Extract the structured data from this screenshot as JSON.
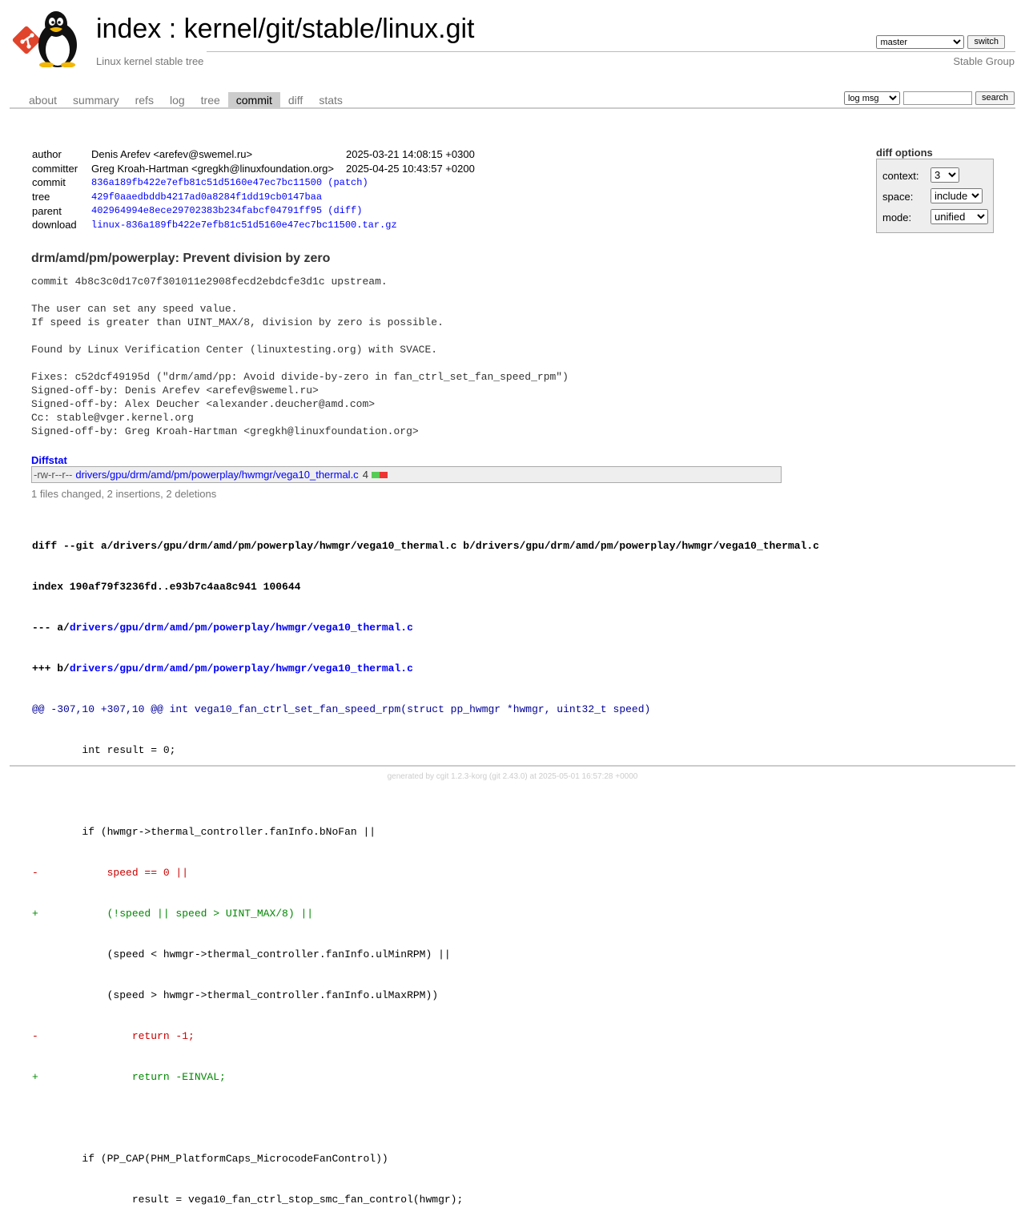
{
  "header": {
    "title_index": "index",
    "title_sep": " : ",
    "title_repo": "kernel/git/stable/linux.git",
    "subtitle": "Linux kernel stable tree",
    "owner": "Stable Group",
    "branch_selected": "master",
    "switch_label": "switch"
  },
  "tabs": [
    {
      "label": "about"
    },
    {
      "label": "summary"
    },
    {
      "label": "refs"
    },
    {
      "label": "log"
    },
    {
      "label": "tree"
    },
    {
      "label": "commit",
      "active": true
    },
    {
      "label": "diff"
    },
    {
      "label": "stats"
    }
  ],
  "search": {
    "mode_selected": "log msg",
    "query": "",
    "button_label": "search"
  },
  "commit_info": {
    "author_label": "author",
    "author": "Denis Arefev <arefev@swemel.ru>",
    "author_date": "2025-03-21 14:08:15 +0300",
    "committer_label": "committer",
    "committer": "Greg Kroah-Hartman <gregkh@linuxfoundation.org>",
    "committer_date": "2025-04-25 10:43:57 +0200",
    "commit_label": "commit",
    "commit_sha": "836a189fb422e7efb81c51d5160e47ec7bc11500",
    "patch_link": "patch",
    "tree_label": "tree",
    "tree_sha": "429f0aaedbddb4217ad0a8284f1dd19cb0147baa",
    "parent_label": "parent",
    "parent_sha": "402964994e8ece29702383b234fabcf04791ff95",
    "diff_link": "diff",
    "download_label": "download",
    "download_file": "linux-836a189fb422e7efb81c51d5160e47ec7bc11500.tar.gz"
  },
  "diff_options": {
    "title": "diff options",
    "context_label": "context:",
    "context_value": "3",
    "space_label": "space:",
    "space_value": "include",
    "mode_label": "mode:",
    "mode_value": "unified"
  },
  "message": {
    "subject": "drm/amd/pm/powerplay: Prevent division by zero",
    "body": "commit 4b8c3c0d17c07f301011e2908fecd2ebdcfe3d1c upstream.\n\nThe user can set any speed value.\nIf speed is greater than UINT_MAX/8, division by zero is possible.\n\nFound by Linux Verification Center (linuxtesting.org) with SVACE.\n\nFixes: c52dcf49195d (\"drm/amd/pp: Avoid divide-by-zero in fan_ctrl_set_fan_speed_rpm\")\nSigned-off-by: Denis Arefev <arefev@swemel.ru>\nSigned-off-by: Alex Deucher <alexander.deucher@amd.com>\nCc: stable@vger.kernel.org\nSigned-off-by: Greg Kroah-Hartman <gregkh@linuxfoundation.org>"
  },
  "diffstat": {
    "title": "Diffstat",
    "mode": "-rw-r--r--",
    "file": "drivers/gpu/drm/amd/pm/powerplay/hwmgr/vega10_thermal.c",
    "changes": "4",
    "summary": "1 files changed, 2 insertions, 2 deletions"
  },
  "diff": {
    "git_line": "diff --git a/drivers/gpu/drm/amd/pm/powerplay/hwmgr/vega10_thermal.c b/drivers/gpu/drm/amd/pm/powerplay/hwmgr/vega10_thermal.c",
    "index_line": "index 190af79f3236fd..e93b7c4aa8c941 100644",
    "minus_prefix": "--- a/",
    "plus_prefix": "+++ b/",
    "file": "drivers/gpu/drm/amd/pm/powerplay/hwmgr/vega10_thermal.c",
    "hunk_range": "@@ -307,10 +307,10 @@",
    "hunk_func": " int vega10_fan_ctrl_set_fan_speed_rpm(struct pp_hwmgr *hwmgr, uint32_t speed)",
    "lines": [
      {
        "t": "ctx",
        "s": "        int result = 0;"
      },
      {
        "t": "ctx",
        "s": " "
      },
      {
        "t": "ctx",
        "s": "        if (hwmgr->thermal_controller.fanInfo.bNoFan ||"
      },
      {
        "t": "del",
        "s": "-           speed == 0 ||"
      },
      {
        "t": "add",
        "s": "+           (!speed || speed > UINT_MAX/8) ||"
      },
      {
        "t": "ctx",
        "s": "            (speed < hwmgr->thermal_controller.fanInfo.ulMinRPM) ||"
      },
      {
        "t": "ctx",
        "s": "            (speed > hwmgr->thermal_controller.fanInfo.ulMaxRPM))"
      },
      {
        "t": "del",
        "s": "-               return -1;"
      },
      {
        "t": "add",
        "s": "+               return -EINVAL;"
      },
      {
        "t": "ctx",
        "s": " "
      },
      {
        "t": "ctx",
        "s": "        if (PP_CAP(PHM_PlatformCaps_MicrocodeFanControl))"
      },
      {
        "t": "ctx",
        "s": "                result = vega10_fan_ctrl_stop_smc_fan_control(hwmgr);"
      }
    ]
  },
  "footer": {
    "text": "generated by cgit 1.2.3-korg (git 2.43.0) at 2025-05-01 16:57:28 +0000"
  }
}
